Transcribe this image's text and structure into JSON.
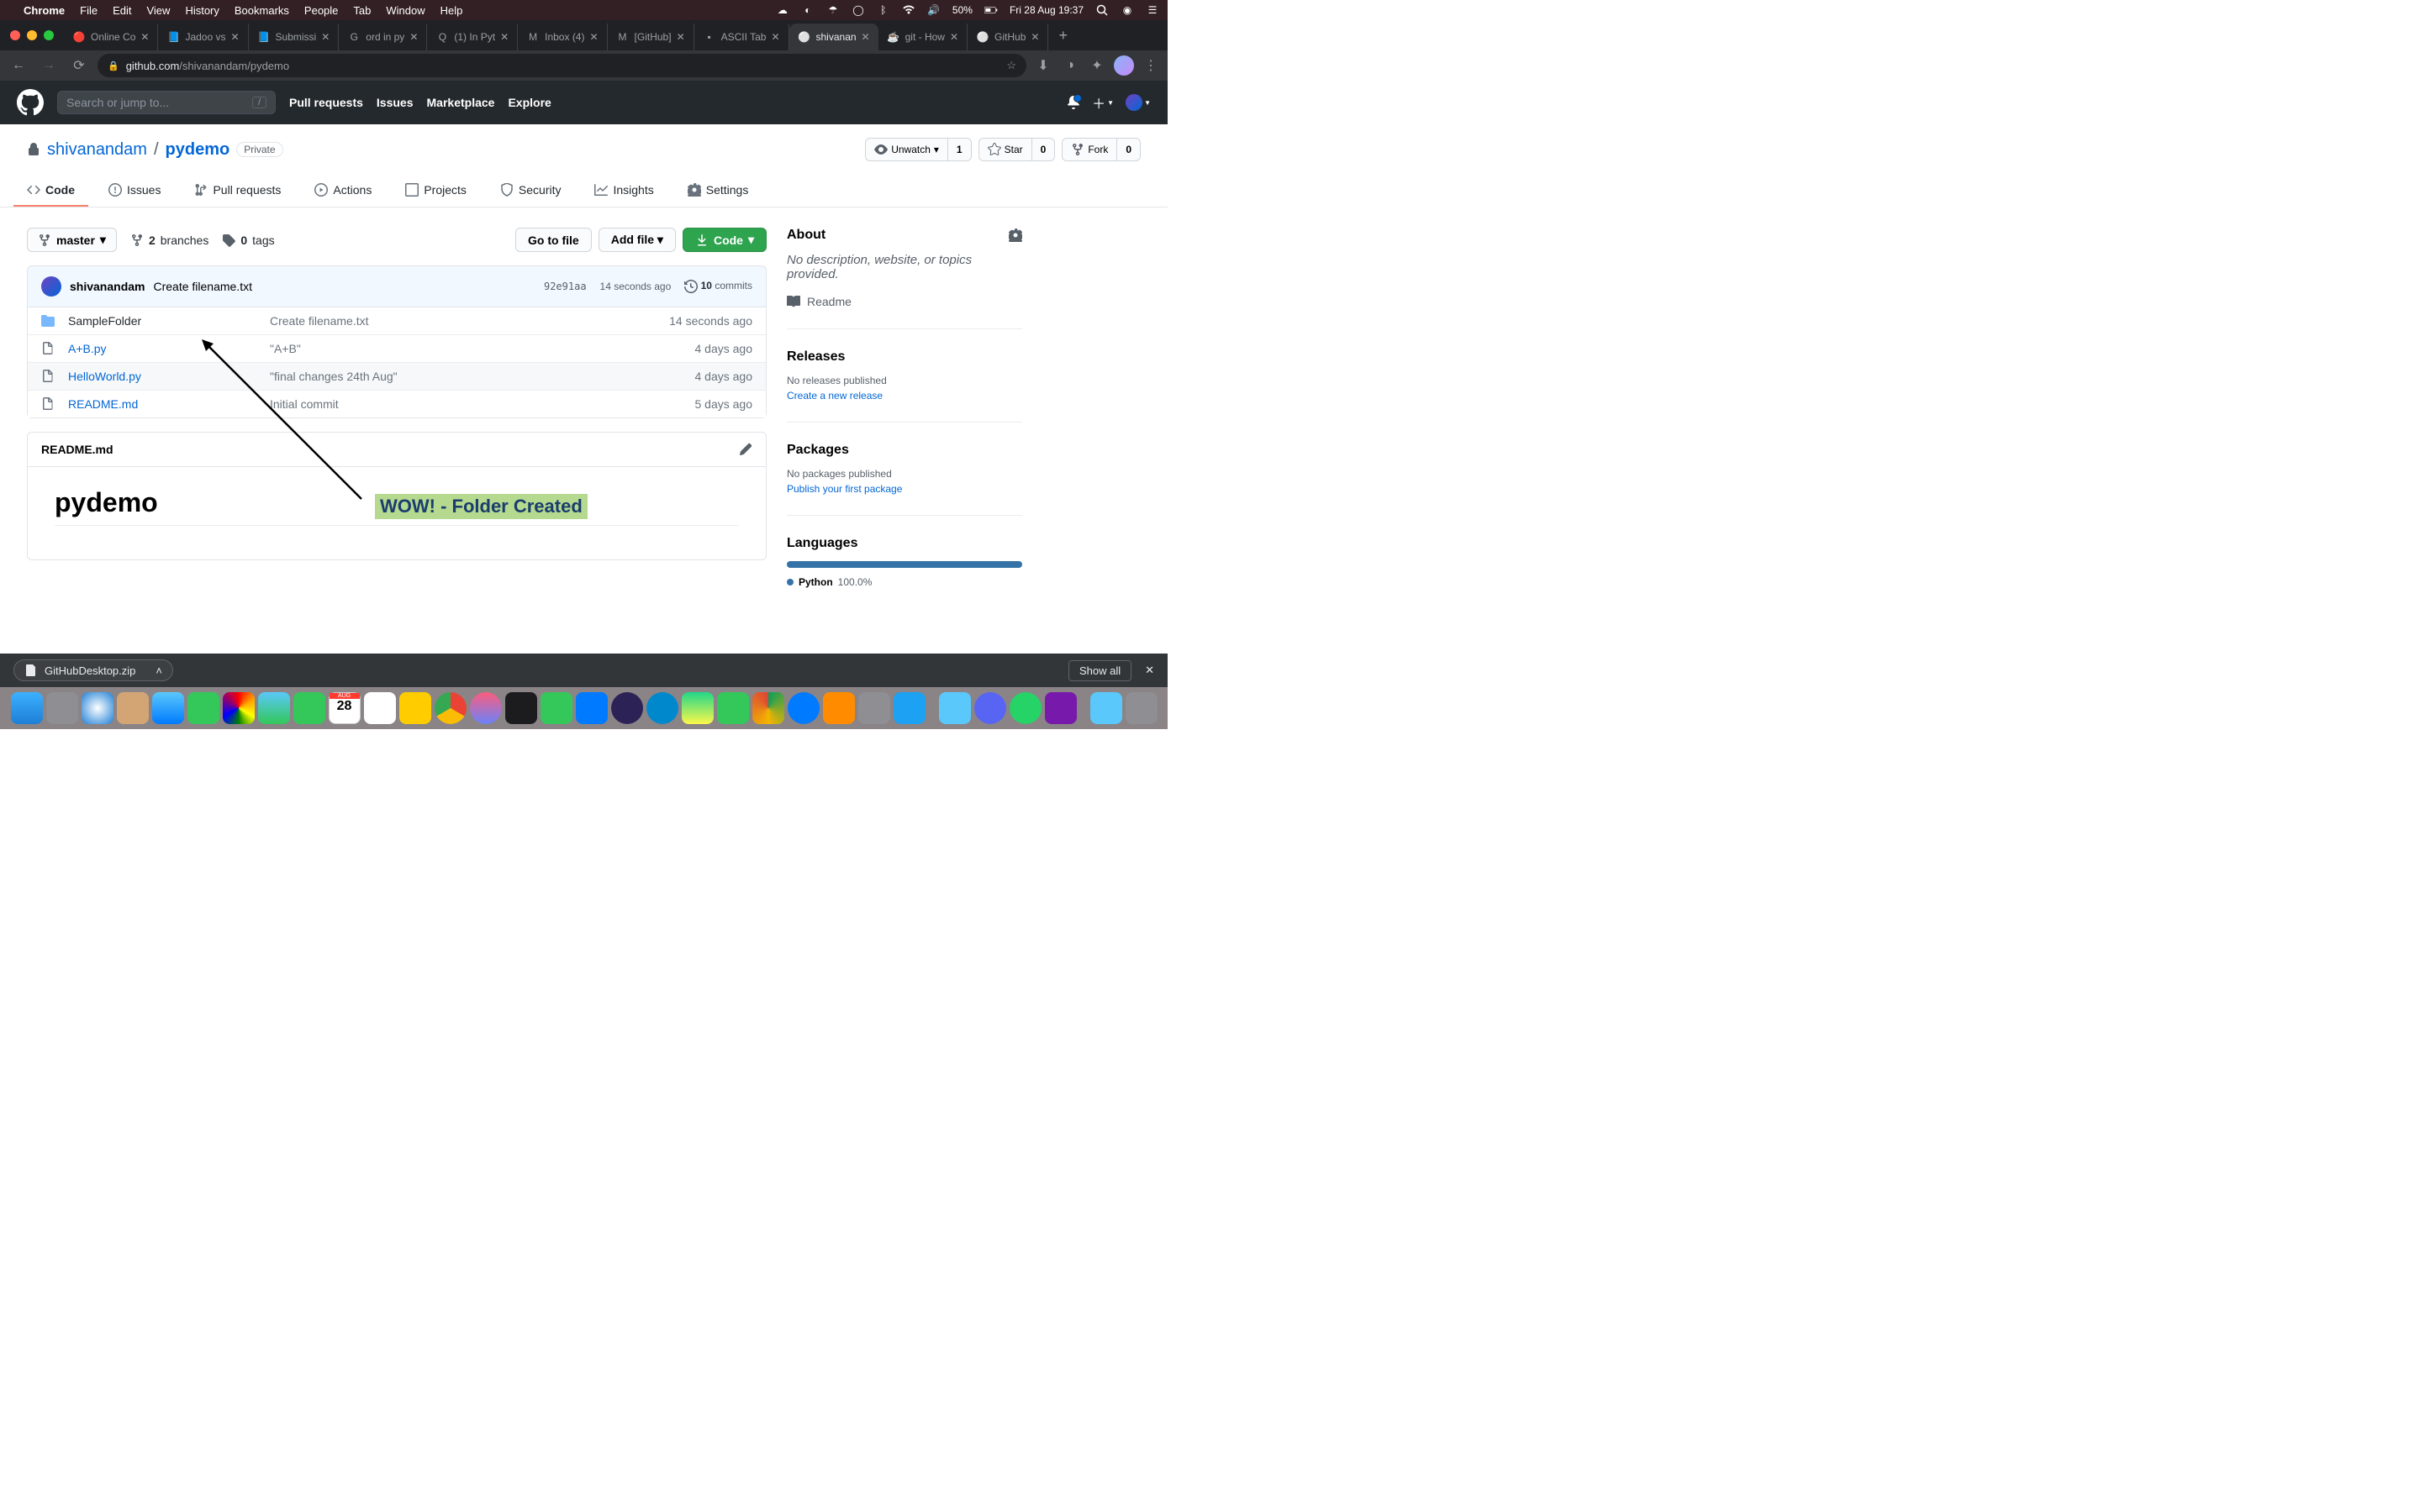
{
  "menubar": {
    "app": "Chrome",
    "items": [
      "File",
      "Edit",
      "View",
      "History",
      "Bookmarks",
      "People",
      "Tab",
      "Window",
      "Help"
    ],
    "battery": "50%",
    "datetime": "Fri 28 Aug  19:37"
  },
  "tabs": [
    {
      "title": "Online Co",
      "favicon": "🔴"
    },
    {
      "title": "Jadoo vs",
      "favicon": "📘"
    },
    {
      "title": "Submissi",
      "favicon": "📘"
    },
    {
      "title": "ord in py",
      "favicon": "G"
    },
    {
      "title": "(1) In Pyt",
      "favicon": "Q"
    },
    {
      "title": "Inbox (4)",
      "favicon": "M"
    },
    {
      "title": "[GitHub]",
      "favicon": "M"
    },
    {
      "title": "ASCII Tab",
      "favicon": "▪"
    },
    {
      "title": "shivanan",
      "favicon": "⚪",
      "active": true
    },
    {
      "title": "git - How",
      "favicon": "☕"
    },
    {
      "title": "GitHub",
      "favicon": "⚪"
    }
  ],
  "url": {
    "domain": "github.com",
    "path": "/shivanandam/pydemo"
  },
  "gh_header": {
    "search_placeholder": "Search or jump to...",
    "nav": [
      "Pull requests",
      "Issues",
      "Marketplace",
      "Explore"
    ]
  },
  "repo": {
    "owner": "shivanandam",
    "name": "pydemo",
    "visibility": "Private",
    "watch": {
      "label": "Unwatch",
      "count": "1"
    },
    "star": {
      "label": "Star",
      "count": "0"
    },
    "fork": {
      "label": "Fork",
      "count": "0"
    }
  },
  "repo_tabs": [
    {
      "label": "Code",
      "icon": "code",
      "active": true
    },
    {
      "label": "Issues",
      "icon": "issue"
    },
    {
      "label": "Pull requests",
      "icon": "pr"
    },
    {
      "label": "Actions",
      "icon": "play"
    },
    {
      "label": "Projects",
      "icon": "project"
    },
    {
      "label": "Security",
      "icon": "shield"
    },
    {
      "label": "Insights",
      "icon": "graph"
    },
    {
      "label": "Settings",
      "icon": "gear"
    }
  ],
  "branch": {
    "current": "master",
    "branches_count": "2",
    "branches_label": "branches",
    "tags_count": "0",
    "tags_label": "tags"
  },
  "actions": {
    "goto": "Go to file",
    "add": "Add file",
    "code": "Code"
  },
  "commit": {
    "author": "shivanandam",
    "message": "Create filename.txt",
    "sha": "92e91aa",
    "time": "14 seconds ago",
    "count": "10",
    "count_label": "commits"
  },
  "files": [
    {
      "type": "folder",
      "name": "SampleFolder",
      "msg": "Create filename.txt",
      "time": "14 seconds ago"
    },
    {
      "type": "file",
      "name": "A+B.py",
      "msg": "\"A+B\"",
      "time": "4 days ago"
    },
    {
      "type": "file",
      "name": "HelloWorld.py",
      "msg": "\"final changes 24th Aug\"",
      "time": "4 days ago"
    },
    {
      "type": "file",
      "name": "README.md",
      "msg": "Initial commit",
      "time": "5 days ago"
    }
  ],
  "readme": {
    "filename": "README.md",
    "heading": "pydemo"
  },
  "sidebar": {
    "about_title": "About",
    "about_desc": "No description, website, or topics provided.",
    "readme_link": "Readme",
    "releases_title": "Releases",
    "releases_none": "No releases published",
    "releases_link": "Create a new release",
    "packages_title": "Packages",
    "packages_none": "No packages published",
    "packages_link": "Publish your first package",
    "languages_title": "Languages",
    "language_name": "Python",
    "language_pct": "100.0%"
  },
  "annotation": "WOW! - Folder Created",
  "download": {
    "filename": "GitHubDesktop.zip",
    "show_all": "Show all"
  }
}
